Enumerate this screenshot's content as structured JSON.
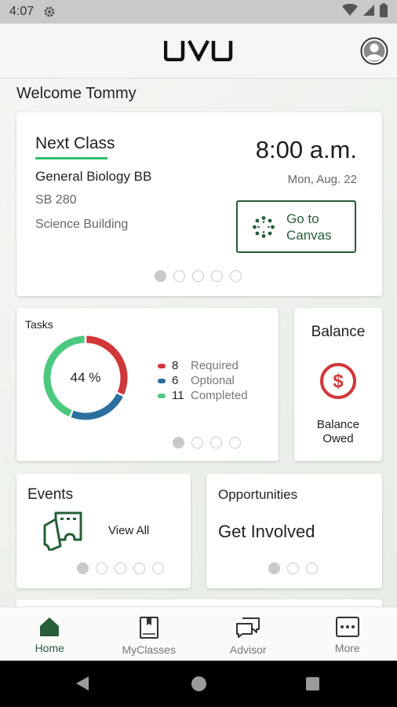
{
  "status_bar": {
    "time": "4:07"
  },
  "header": {
    "logo_text": "UVU"
  },
  "welcome": "Welcome Tommy",
  "next_class": {
    "title": "Next Class",
    "course": "General Biology BB",
    "room": "SB 280",
    "building": "Science Building",
    "time": "8:00 a.m.",
    "date": "Mon, Aug. 22",
    "canvas_button": "Go to\nCanvas",
    "pager": {
      "pages": 5,
      "active": 1
    }
  },
  "tasks": {
    "title": "Tasks",
    "percent_label": "44 %",
    "items": [
      {
        "count": "8",
        "label": "Required",
        "color": "#d13639",
        "value": 8
      },
      {
        "count": "6",
        "label": "Optional",
        "color": "#2a6f9e",
        "value": 6
      },
      {
        "count": "11",
        "label": "Completed",
        "color": "#4cc97f",
        "value": 11
      }
    ],
    "pager": {
      "pages": 4,
      "active": 1
    }
  },
  "balance": {
    "title": "Balance",
    "subtitle": "Balance\nOwed",
    "icon": "dollar-circle-icon",
    "color": "#d13639"
  },
  "events": {
    "title": "Events",
    "link": "View All",
    "icon": "tickets-icon",
    "pager": {
      "pages": 5,
      "active": 1
    }
  },
  "opportunities": {
    "title": "Opportunities",
    "headline": "Get Involved",
    "pager": {
      "pages": 3,
      "active": 1
    }
  },
  "tabbar": {
    "items": [
      {
        "label": "Home",
        "icon": "home-icon",
        "active": true
      },
      {
        "label": "MyClasses",
        "icon": "book-icon",
        "active": false
      },
      {
        "label": "Advisor",
        "icon": "chat-icon",
        "active": false
      },
      {
        "label": "More",
        "icon": "more-icon",
        "active": false
      }
    ]
  },
  "colors": {
    "brand_green": "#275d38",
    "accent_green": "#2fbf71",
    "dot_gray": "#c9c9c9"
  }
}
